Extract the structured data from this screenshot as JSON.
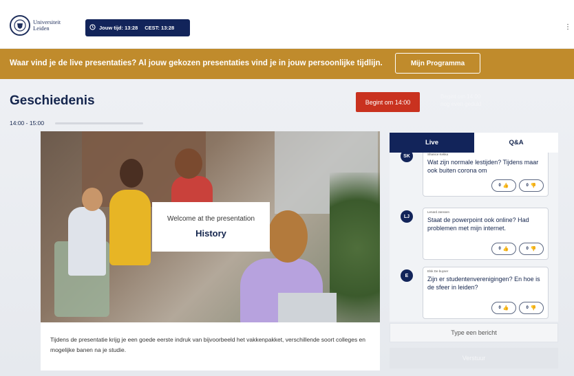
{
  "header": {
    "logo_line1": "Universiteit",
    "logo_line2": "Leiden",
    "local_time_label": "Jouw tijd: 13:28",
    "cest_time_label": "CEST: 13:28",
    "menu_glyph": "⋮"
  },
  "banner": {
    "text": "Waar vind je de live presentaties? Al jouw gekozen presentaties vind je in jouw persoonlijke tijdlijn.",
    "button_label": "Mijn Programma"
  },
  "session": {
    "title": "Geschiedenis",
    "time_range": "14:00 - 15:00",
    "start_button_label": "Begint om 14:00",
    "faded_line1": "Begint om 14:00",
    "faded_line2": "nog even geduld"
  },
  "video": {
    "welcome_subtitle": "Welcome at the presentation",
    "welcome_title": "History"
  },
  "description": "Tijdens de presentatie krijg je een goede eerste indruk van bijvoorbeeld het vakkenpakket, verschillende soort colleges en mogelijke banen na je studie.",
  "chat": {
    "tab_live": "Live",
    "tab_qa": "Q&A",
    "messages": [
      {
        "initials": "SK",
        "author": "Shanice Kekka",
        "text": "Wat zijn normale lestijden? Tijdens maar ook buiten corona om",
        "likes": "0",
        "dislikes": "0"
      },
      {
        "initials": "LJ",
        "author": "Lenard Janssen",
        "text": "Staat de powerpoint ook online? Had problemen met mijn internet.",
        "likes": "0",
        "dislikes": "0"
      },
      {
        "initials": "E",
        "author": "Elsk De buyser",
        "text": "Zijn er studentenverenigingen? En hoe is de sfeer in leiden?",
        "likes": "0",
        "dislikes": "0"
      }
    ],
    "input_placeholder": "Type een bericht",
    "send_label": "Verstuur"
  },
  "colors": {
    "navy": "#12245a",
    "banner_gold": "#c08b2c",
    "start_red": "#c9321f"
  }
}
